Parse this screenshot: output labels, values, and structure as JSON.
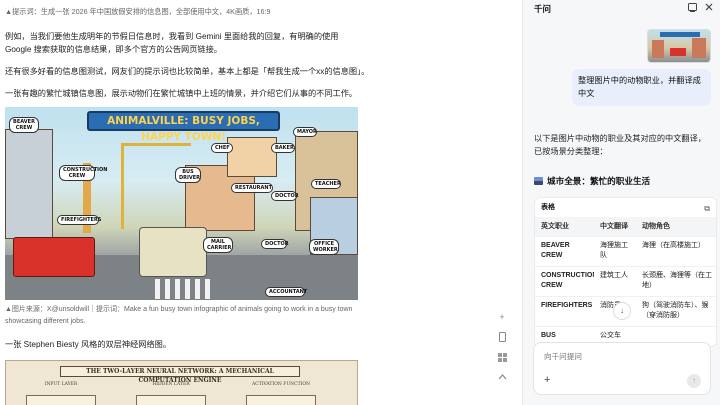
{
  "article": {
    "top_caption": "▲提示词：生成一张 2026 年中国放假安排的信息图，全部使用中文，4K画质，16:9",
    "p1": "例如，当我们要他生成明年的节假日信息时，我看到 Gemini 里面给我的回复，有明确的使用 Google 搜索获取的信息结果，即多个官方的公告网页链接。",
    "p2": "还有很多好看的信息图测试，网友们的提示词也比较简单，基本上都是「帮我生成一个xx的信息图」。",
    "p3": "一张有趣的繁忙城镇信息图，展示动物们在繁忙城镇中上班的情景，并介绍它们从事的不同工作。",
    "infographic": {
      "title": "ANIMALVILLE: BUSY JOBS, HAPPY TOWN!",
      "labels": [
        "BEAVER CREW",
        "CONSTRUCTION CREW",
        "CHEF",
        "BAKER",
        "MAYOR",
        "BUS DRIVER",
        "RESTAURANT",
        "TEACHER",
        "FIREFIGHTERS",
        "DOCTOR",
        "MAIL CARRIER",
        "DOCTOR",
        "OFFICE WORKER",
        "ACCOUNTANT"
      ]
    },
    "img_caption": "▲图片来源：X@unsoldwill｜提示词：Make a fun busy town infographic of animals going to work in a busy town showcasing different jobs.",
    "p4": "一张 Stephen Biesty 风格的双层神经网络图。",
    "diagram": {
      "title": "THE TWO-LAYER NEURAL NETWORK: A MECHANICAL COMPUTATION ENGINE",
      "layers": [
        "INPUT LAYER",
        "HIDDEN LAYER",
        "ACTIVATION FUNCTION"
      ]
    }
  },
  "float_tools": [
    "plus-icon",
    "phone-icon",
    "grid-icon",
    "up-icon"
  ],
  "panel": {
    "title": "千问",
    "user_message": "整理图片中的动物职业，并翻译成中文",
    "reply_intro": "以下是图片中动物的职业及其对应的中文翻译，已按场景分类整理：",
    "section_heading": "城市全景：繁忙的职业生活",
    "table": {
      "label": "表格",
      "headers": [
        "英文职业",
        "中文翻译",
        "动物角色"
      ],
      "rows": [
        [
          "BEAVER CREW",
          "海狸施工队",
          "海狸（在高楼施工）"
        ],
        [
          "CONSTRUCTION CREW",
          "建筑工人",
          "长颈鹿、海狸等（在工地）"
        ],
        [
          "FIREFIGHTERS",
          "消防员",
          "狗（驾驶消防车）、猴（穿消防服）"
        ],
        [
          "BUS",
          "公交车",
          ""
        ]
      ]
    },
    "composer_placeholder": "向千问提问"
  }
}
